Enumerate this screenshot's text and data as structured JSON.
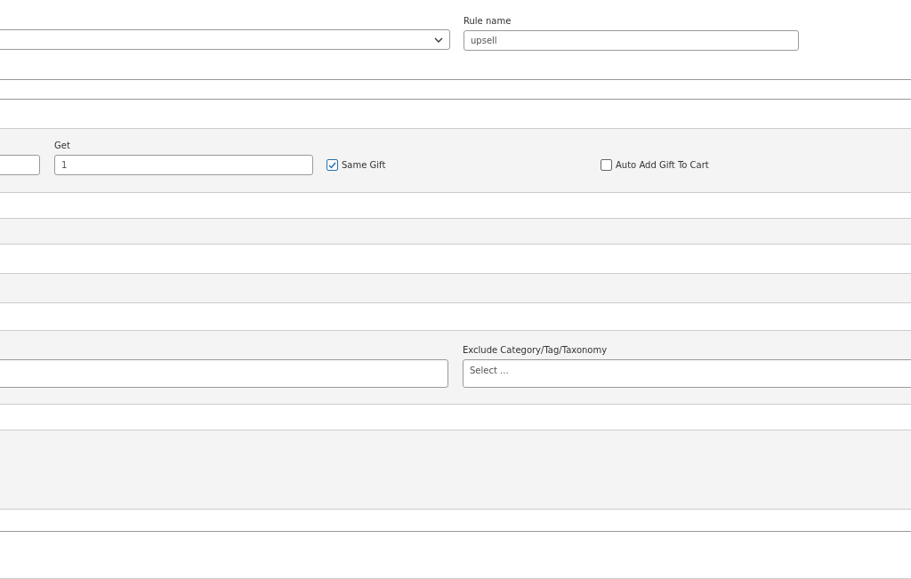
{
  "rule_name": {
    "label": "Rule name",
    "value": "upsell"
  },
  "get": {
    "label": "Get",
    "value": "1"
  },
  "options": [
    {
      "label": "Same Gift",
      "checked": true
    },
    {
      "label": "Auto Add Gift To Cart",
      "checked": false
    }
  ],
  "exclude": {
    "label": "Exclude Category/Tag/Taxonomy",
    "placeholder": "Select ..."
  }
}
